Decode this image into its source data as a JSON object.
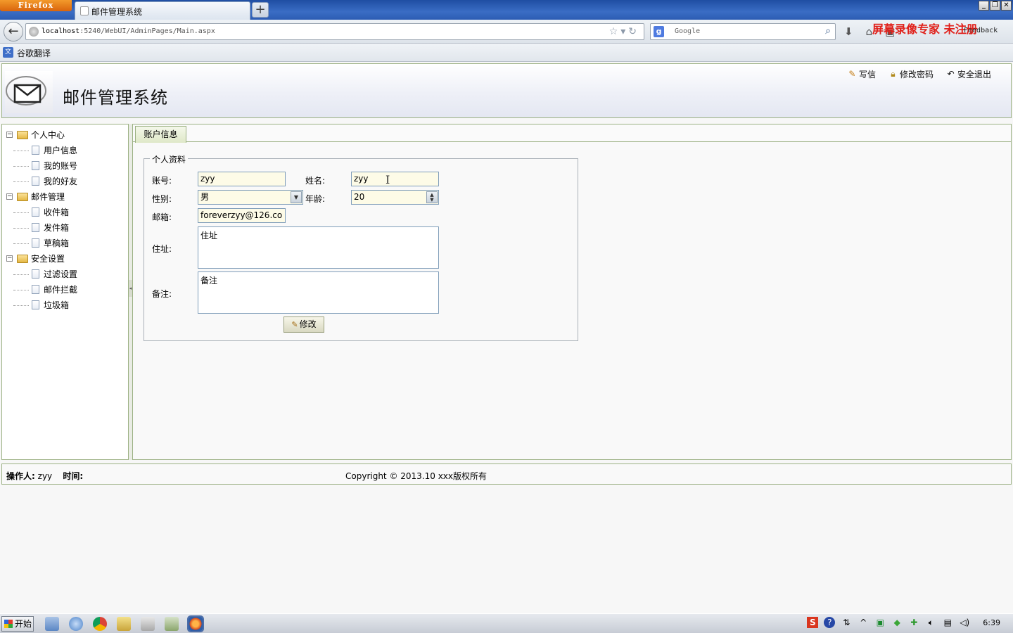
{
  "browser": {
    "menu_button": "Firefox",
    "tab_title": "邮件管理系统",
    "new_tab": "+",
    "url_host": "localhost",
    "url_path": ":5240/WebUI/AdminPages/Main.aspx",
    "search_engine_icon": "g-icon",
    "search_placeholder": "Google",
    "watermark": "屏幕录像专家 未注册",
    "feedback": "Feedback",
    "bookmark": "谷歌翻译"
  },
  "header": {
    "title": "邮件管理系统",
    "links": [
      {
        "label": "写信",
        "icon": "pencil-icon"
      },
      {
        "label": "修改密码",
        "icon": "lock-icon"
      },
      {
        "label": "安全退出",
        "icon": "exit-icon"
      }
    ]
  },
  "sidebar": {
    "groups": [
      {
        "label": "个人中心",
        "items": [
          "用户信息",
          "我的账号",
          "我的好友"
        ]
      },
      {
        "label": "邮件管理",
        "items": [
          "收件箱",
          "发件箱",
          "草稿箱"
        ]
      },
      {
        "label": "安全设置",
        "items": [
          "过滤设置",
          "邮件拦截",
          "垃圾箱"
        ]
      }
    ]
  },
  "main": {
    "active_tab": "账户信息",
    "fieldset_legend": "个人资料",
    "form": {
      "account_label": "账号:",
      "account_value": "zyy",
      "name_label": "姓名:",
      "name_value": "zyy",
      "gender_label": "性别:",
      "gender_value": "男",
      "age_label": "年龄:",
      "age_value": "20",
      "email_label": "邮箱:",
      "email_value": "foreverzyy@126.co",
      "address_label": "住址:",
      "address_value": "住址",
      "remark_label": "备注:",
      "remark_value": "备注",
      "submit_label": "修改"
    }
  },
  "footer": {
    "operator_label": "操作人:",
    "operator_value": "zyy",
    "time_label": "时间:",
    "copyright": "Copyright © 2013.10 xxx版权所有"
  },
  "taskbar": {
    "start_label": "开始",
    "clock": "6:39"
  }
}
